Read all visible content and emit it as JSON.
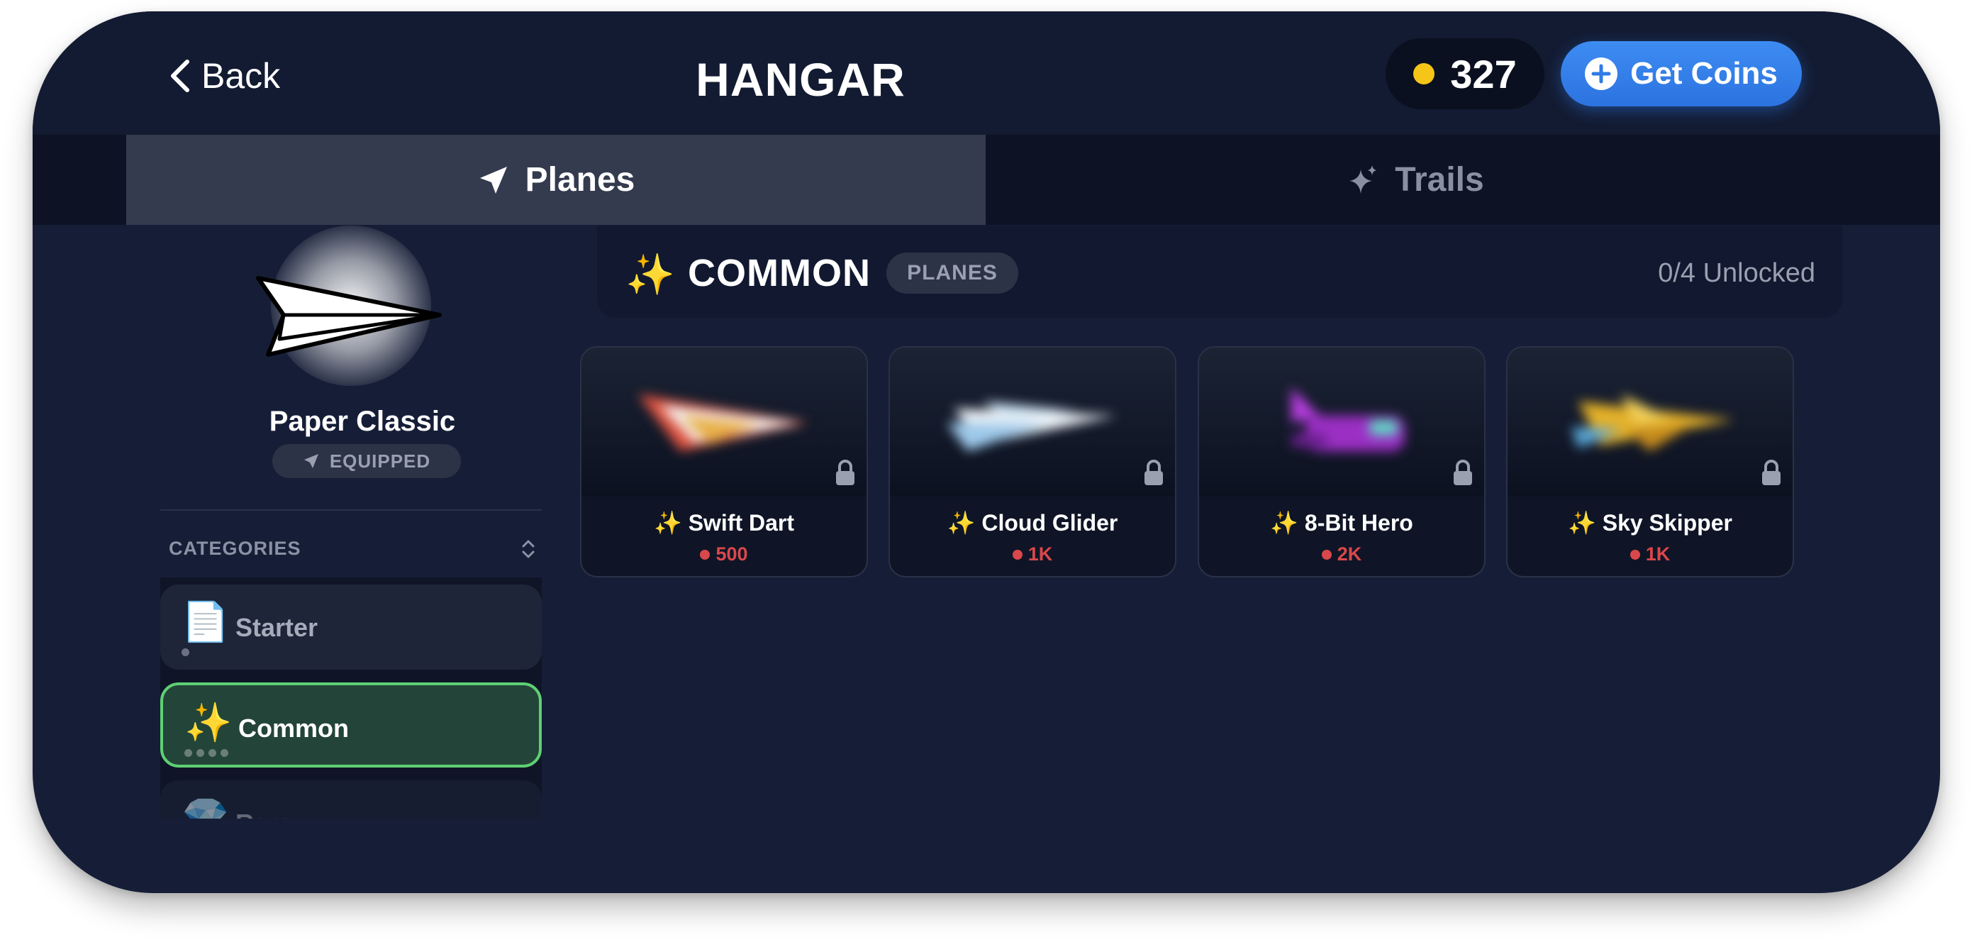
{
  "header": {
    "back_label": "Back",
    "title": "HANGAR",
    "coin_balance": "327",
    "get_coins_label": "Get Coins"
  },
  "tabs": [
    {
      "label": "Planes",
      "icon": "paper-plane-icon",
      "active": true
    },
    {
      "label": "Trails",
      "icon": "sparkles-icon",
      "active": false
    }
  ],
  "equipped_plane": {
    "name": "Paper Classic",
    "status": "EQUIPPED"
  },
  "categories": {
    "header": "CATEGORIES",
    "items": [
      {
        "emoji": "📄",
        "label": "Starter",
        "dots": 1,
        "selected": false
      },
      {
        "emoji": "✨",
        "label": "Common",
        "dots": 4,
        "selected": true
      },
      {
        "emoji": "💎",
        "label": "Rare",
        "selected": false
      }
    ]
  },
  "section": {
    "emoji": "✨",
    "title": "COMMON",
    "badge": "PLANES",
    "unlocked": "0/4 Unlocked"
  },
  "planes": [
    {
      "emoji": "✨",
      "name": "Swift Dart",
      "price": "500",
      "locked": true,
      "color": "#e0533f"
    },
    {
      "emoji": "✨",
      "name": "Cloud Glider",
      "price": "1K",
      "locked": true,
      "color": "#9ec9ea"
    },
    {
      "emoji": "✨",
      "name": "8-Bit Hero",
      "price": "2K",
      "locked": true,
      "color": "#9b2fc4"
    },
    {
      "emoji": "✨",
      "name": "Sky Skipper",
      "price": "1K",
      "locked": true,
      "color": "#e3b02a"
    }
  ],
  "colors": {
    "background": "#161e37",
    "accent_blue": "#2f7be6",
    "coin_yellow": "#f5c518",
    "selected_green": "#5fcf74",
    "price_red": "#d9484b"
  }
}
